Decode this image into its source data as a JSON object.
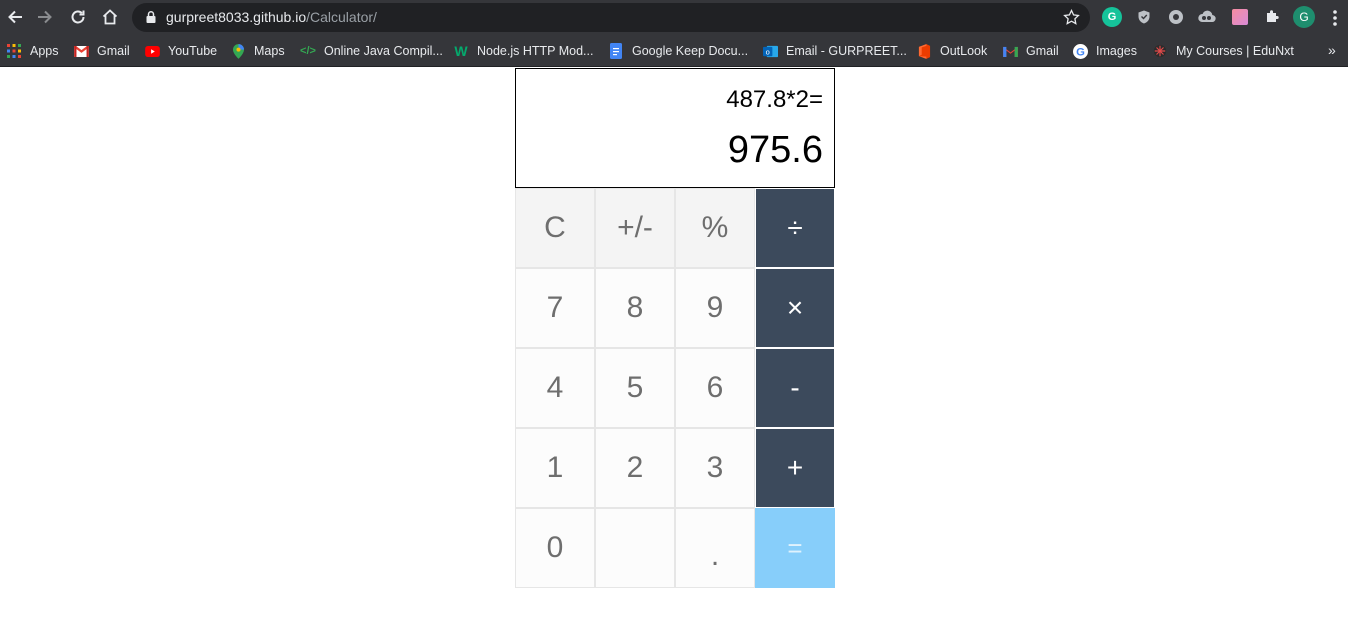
{
  "browser": {
    "url_host": "gurpreet8033.github.io",
    "url_path": "/Calculator/",
    "profile_initial": "G",
    "extension_g_label": "G"
  },
  "bookmarks": [
    {
      "label": "Apps",
      "icon": "apps-grid-icon"
    },
    {
      "label": "Gmail",
      "icon": "gmail-icon"
    },
    {
      "label": "YouTube",
      "icon": "youtube-icon"
    },
    {
      "label": "Maps",
      "icon": "maps-pin-icon"
    },
    {
      "label": "Online Java Compil...",
      "icon": "code-icon"
    },
    {
      "label": "Node.js HTTP Mod...",
      "icon": "w3schools-icon"
    },
    {
      "label": "Google Keep Docu...",
      "icon": "docs-icon"
    },
    {
      "label": "Email - GURPREET...",
      "icon": "outlook-icon"
    },
    {
      "label": "OutLook",
      "icon": "office-icon"
    },
    {
      "label": "Gmail",
      "icon": "gmail-icon"
    },
    {
      "label": "Images",
      "icon": "google-icon"
    },
    {
      "label": "My Courses | EduNxt",
      "icon": "edunxt-icon"
    }
  ],
  "bookmarks_overflow": "»",
  "calculator": {
    "expression": "487.8*2=",
    "result": "975.6",
    "keys": {
      "clear": "C",
      "sign": "+/-",
      "percent": "%",
      "divide": "÷",
      "seven": "7",
      "eight": "8",
      "nine": "9",
      "multiply": "×",
      "four": "4",
      "five": "5",
      "six": "6",
      "subtract": "-",
      "one": "1",
      "two": "2",
      "three": "3",
      "add": "+",
      "zero": "0",
      "blank": "",
      "decimal": ".",
      "equals": "="
    },
    "colors": {
      "operator_bg": "#3c4a5c",
      "equals_bg": "#87cefa",
      "key_text": "#6e6e6e"
    }
  }
}
